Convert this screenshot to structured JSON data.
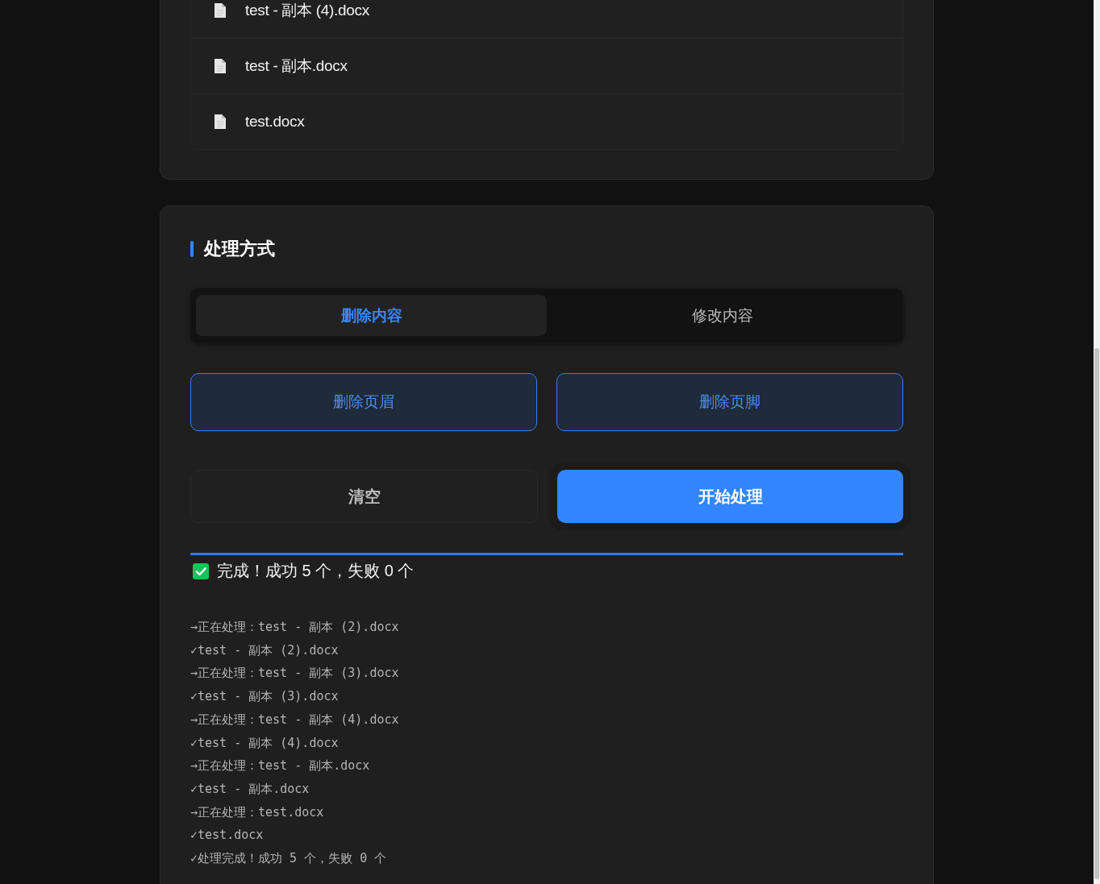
{
  "files": [
    {
      "name": "test - 副本 (4).docx"
    },
    {
      "name": "test - 副本.docx"
    },
    {
      "name": "test.docx"
    }
  ],
  "mode_section": {
    "title": "处理方式",
    "tabs": [
      {
        "label": "删除内容",
        "selected": true
      },
      {
        "label": "修改内容",
        "selected": false
      }
    ],
    "options": [
      {
        "label": "删除页眉",
        "selected": true
      },
      {
        "label": "删除页脚",
        "selected": true
      }
    ],
    "actions": [
      {
        "label": "清空",
        "kind": "secondary"
      },
      {
        "label": "开始处理",
        "kind": "primary"
      }
    ],
    "progress": {
      "level": 1
    },
    "status": "完成！成功 5 个，失败 0 个",
    "log": [
      "→正在处理：test - 副本 (2).docx",
      "✓test - 副本 (2).docx",
      "→正在处理：test - 副本 (3).docx",
      "✓test - 副本 (3).docx",
      "→正在处理：test - 副本 (4).docx",
      "✓test - 副本 (4).docx",
      "→正在处理：test - 副本.docx",
      "✓test - 副本.docx",
      "→正在处理：test.docx",
      "✓test.docx",
      "✓处理完成！成功 5 个，失败 0 个"
    ]
  }
}
